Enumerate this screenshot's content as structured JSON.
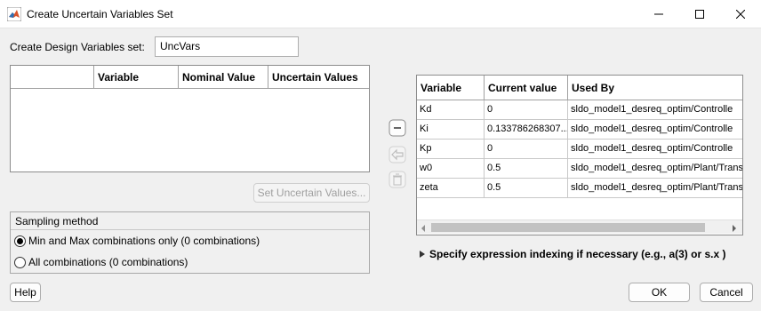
{
  "window": {
    "title": "Create Uncertain Variables Set"
  },
  "design_set": {
    "label": "Create Design Variables set:",
    "value": "UncVars"
  },
  "uncertain_table": {
    "columns": [
      "",
      "Variable",
      "Nominal Value",
      "Uncertain Values"
    ]
  },
  "set_uncertain_button": "Set Uncertain Values...",
  "sampling": {
    "title": "Sampling method",
    "options": [
      {
        "label": "Min and Max combinations only (0 combinations)",
        "selected": true
      },
      {
        "label": "All combinations (0 combinations)",
        "selected": false
      }
    ]
  },
  "variables_table": {
    "columns": [
      "Variable",
      "Current value",
      "Used By"
    ],
    "rows": [
      {
        "variable": "Kd",
        "current": "0",
        "used_by": "sldo_model1_desreq_optim/Controlle"
      },
      {
        "variable": "Ki",
        "current": "0.133786268307...",
        "used_by": "sldo_model1_desreq_optim/Controlle"
      },
      {
        "variable": "Kp",
        "current": "0",
        "used_by": "sldo_model1_desreq_optim/Controlle"
      },
      {
        "variable": "w0",
        "current": "0.5",
        "used_by": "sldo_model1_desreq_optim/Plant/Transfe"
      },
      {
        "variable": "zeta",
        "current": "0.5",
        "used_by": "sldo_model1_desreq_optim/Plant/Transfe"
      }
    ]
  },
  "expression_indexing": "Specify expression indexing if necessary (e.g., a(3) or s.x )",
  "buttons": {
    "help": "Help",
    "ok": "OK",
    "cancel": "Cancel"
  },
  "colors": {
    "scroll_thumb": "#c2c2c2",
    "accent": "#0078d7"
  }
}
